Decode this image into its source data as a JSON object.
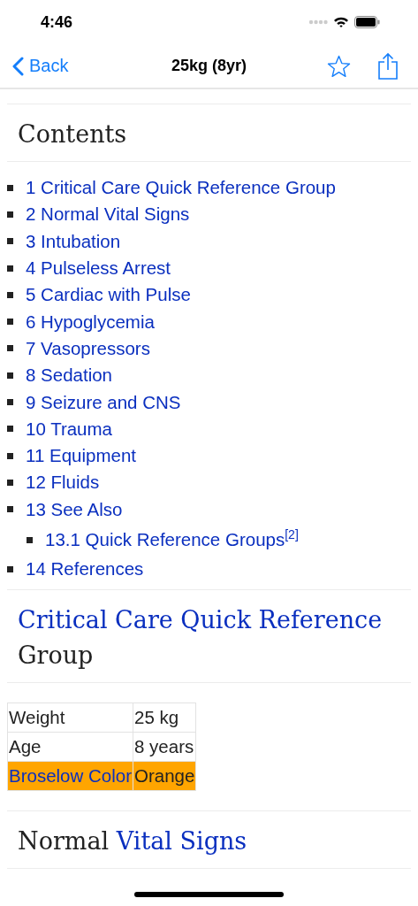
{
  "status_bar": {
    "time": "4:46"
  },
  "nav_bar": {
    "back": "Back",
    "title": "25kg (8yr)",
    "favorite": false
  },
  "contents": {
    "title": "Contents",
    "items": [
      {
        "text": "1 Critical Care Quick Reference Group"
      },
      {
        "text": "2 Normal Vital Signs"
      },
      {
        "text": "3 Intubation"
      },
      {
        "text": "4 Pulseless Arrest"
      },
      {
        "text": "5 Cardiac with Pulse"
      },
      {
        "text": "6 Hypoglycemia"
      },
      {
        "text": "7 Vasopressors"
      },
      {
        "text": "8 Sedation"
      },
      {
        "text": "9 Seizure and CNS"
      },
      {
        "text": "10 Trauma"
      },
      {
        "text": "11 Equipment"
      },
      {
        "text": "12 Fluids"
      },
      {
        "text": "13 See Also",
        "children": [
          {
            "text": "13.1 Quick Reference Groups$^{[2]}$"
          }
        ]
      },
      {
        "text": "14 References"
      }
    ]
  },
  "sections": [
    {
      "heading": [
        {
          "text": "Critical Care Quick Reference",
          "link": true
        },
        {
          "text": "Group",
          "link": false
        }
      ],
      "table": [
        {
          "cells": [
            {
              "text": "Weight",
              "link": false
            },
            {
              "text": "25 kg",
              "link": false
            }
          ]
        },
        {
          "cells": [
            {
              "text": "Age",
              "link": false
            },
            {
              "text": "8 years",
              "link": false
            }
          ]
        },
        {
          "color": "#ffa500",
          "cells": [
            {
              "text": "Broselow Color",
              "link": true
            },
            {
              "text": "Orange",
              "link": false
            }
          ]
        }
      ]
    },
    {
      "heading": [
        {
          "text": "Normal",
          "link": false
        },
        {
          "text": "Vital Signs",
          "link": true
        }
      ]
    }
  ]
}
